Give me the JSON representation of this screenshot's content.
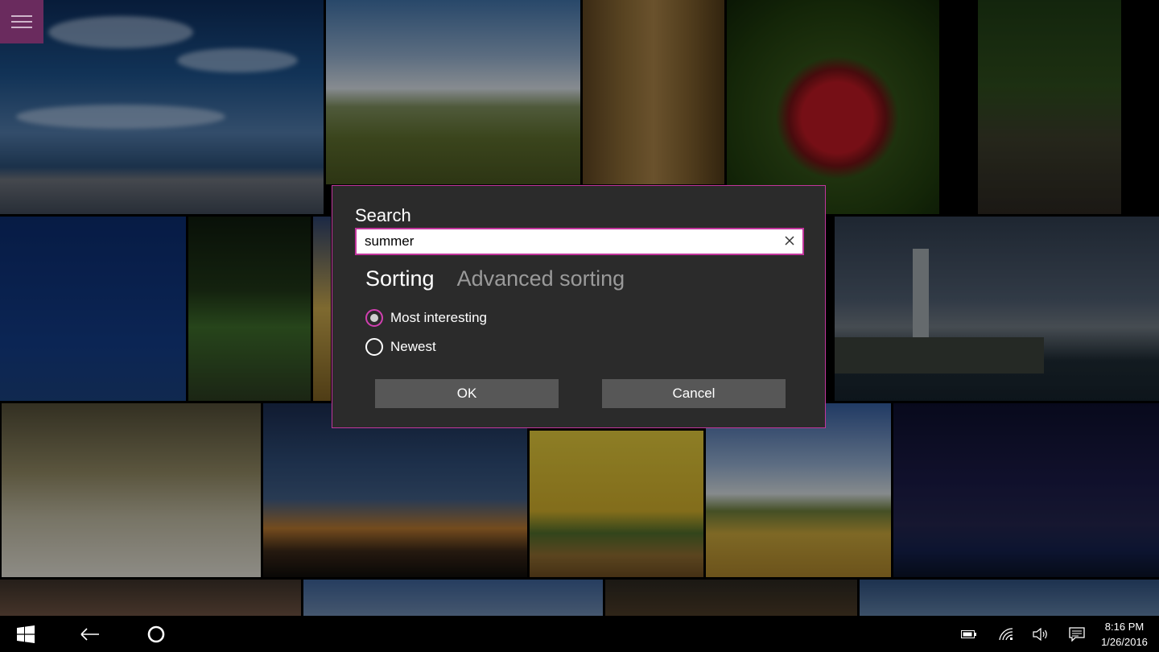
{
  "app": {
    "menu_icon": "hamburger-icon",
    "accent_color": "#c2359c"
  },
  "dialog": {
    "title": "Search",
    "search_value": "summer",
    "clear_icon": "close-icon",
    "tabs": [
      {
        "label": "Sorting",
        "active": true
      },
      {
        "label": "Advanced sorting",
        "active": false
      }
    ],
    "options": [
      {
        "label": "Most interesting",
        "checked": true
      },
      {
        "label": "Newest",
        "checked": false
      }
    ],
    "ok_label": "OK",
    "cancel_label": "Cancel"
  },
  "taskbar": {
    "start_icon": "windows-icon",
    "back_icon": "back-arrow-icon",
    "cortana_icon": "cortana-circle-icon",
    "tray_icons": [
      "battery-icon",
      "wifi-icon",
      "volume-icon",
      "notifications-icon"
    ],
    "time": "8:16 PM",
    "date": "1/26/2016"
  }
}
